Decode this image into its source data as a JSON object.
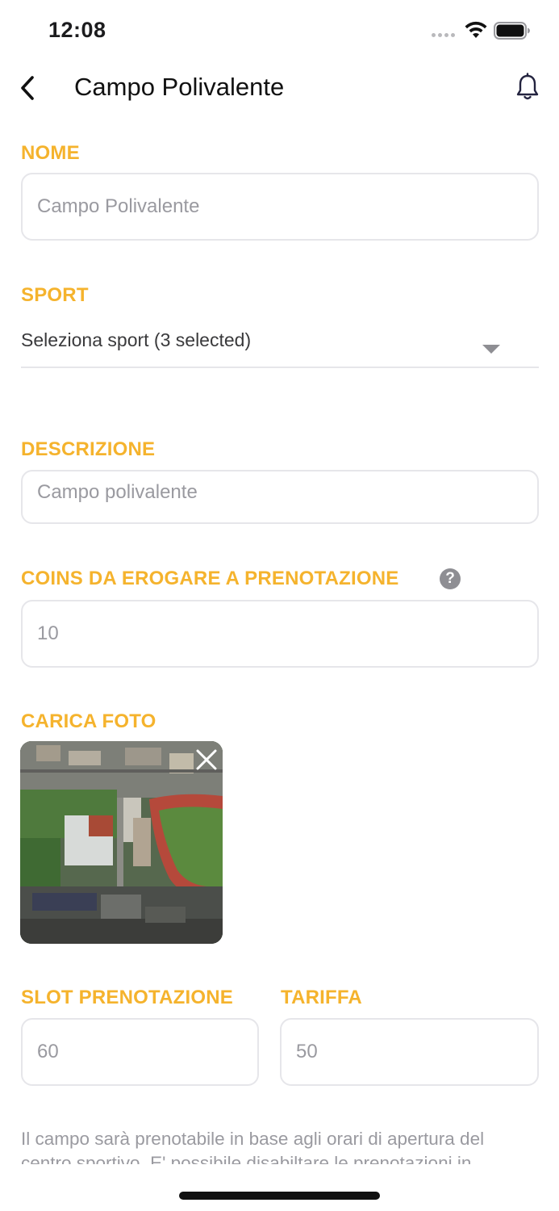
{
  "status_bar": {
    "time": "12:08"
  },
  "header": {
    "title": "Campo Polivalente"
  },
  "form": {
    "nome": {
      "label": "NOME",
      "placeholder": "Campo Polivalente"
    },
    "sport": {
      "label": "SPORT",
      "value": "Seleziona sport (3 selected)"
    },
    "descrizione": {
      "label": "DESCRIZIONE",
      "placeholder": "Campo polivalente"
    },
    "coins": {
      "label": "COINS DA EROGARE A PRENOTAZIONE",
      "help": "?",
      "placeholder": "10"
    },
    "foto": {
      "label": "CARICA FOTO"
    },
    "slot": {
      "label": "SLOT PRENOTAZIONE",
      "placeholder": "60"
    },
    "tariffa": {
      "label": "TARIFFA",
      "placeholder": "50"
    }
  },
  "footer_note": "Il campo sarà prenotabile in base agli orari di apertura del centro sportivo. E' possibile disabiltare le prenotazioni in",
  "colors": {
    "accent": "#f5b32d",
    "border": "#e6e6ea",
    "placeholder": "#9a9aa0"
  }
}
